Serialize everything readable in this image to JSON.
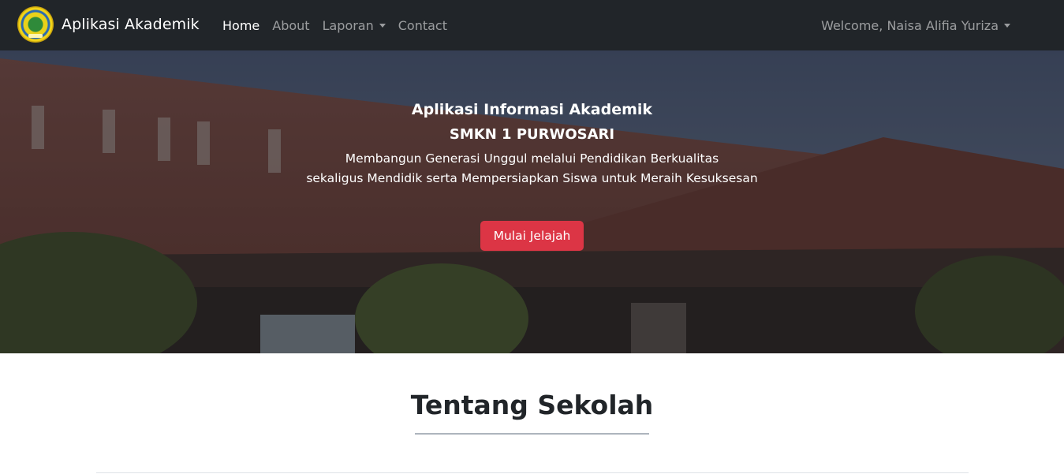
{
  "navbar": {
    "brand": "Aplikasi Akademik",
    "logo_icon": "school-emblem-icon",
    "links": [
      {
        "label": "Home",
        "active": true
      },
      {
        "label": "About",
        "active": false
      },
      {
        "label": "Laporan",
        "active": false,
        "dropdown": true
      },
      {
        "label": "Contact",
        "active": false
      }
    ],
    "user_menu": "Welcome, Naisa Alifia Yuriza"
  },
  "hero": {
    "title": "Aplikasi Informasi Akademik",
    "school": "SMKN 1 PURWOSARI",
    "description_line1": "Membangun Generasi Unggul melalui Pendidikan Berkualitas",
    "description_line2": "sekaligus Mendidik serta Mempersiapkan Siswa untuk Meraih Kesuksesan",
    "button": "Mulai Jelajah",
    "button_color": "#dc3545"
  },
  "about": {
    "title": "Tentang Sekolah"
  },
  "colors": {
    "navbar_bg": "#212529",
    "accent": "#dc3545"
  }
}
